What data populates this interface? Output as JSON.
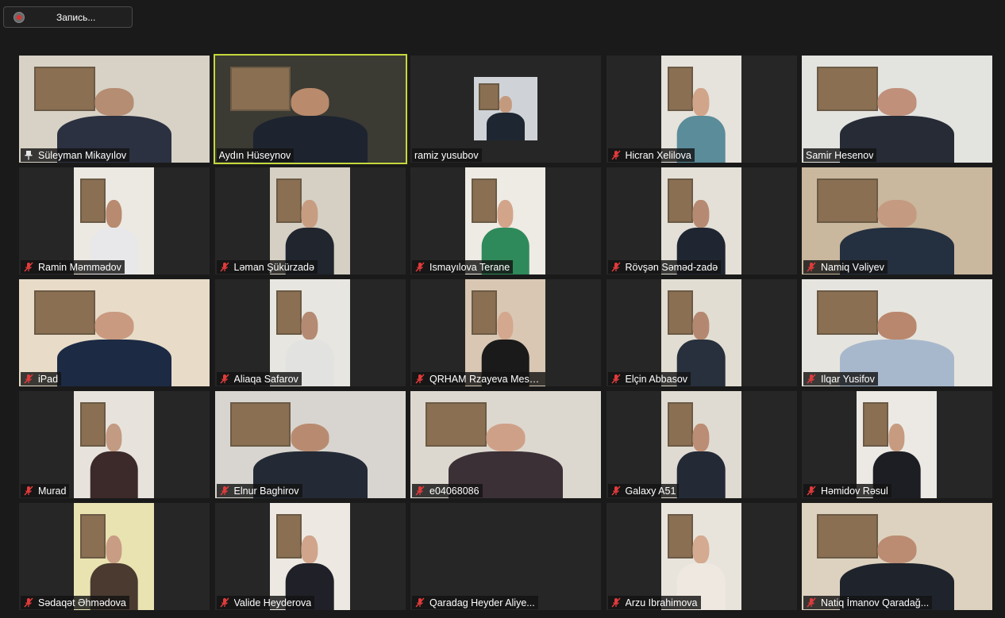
{
  "recording": {
    "label": "Запись..."
  },
  "participants": [
    {
      "name": "Süleyman Mikayılov",
      "icon": "pin-icon",
      "muted": false,
      "active": false,
      "layout": "full",
      "wall": "#d8d2c6",
      "skin": "#b58d73",
      "suit": "#2b3140"
    },
    {
      "name": "Aydın Hüseynov",
      "icon": "none",
      "muted": false,
      "active": true,
      "layout": "full",
      "wall": "#3b3a33",
      "skin": "#b98a6c",
      "suit": "#1d2430"
    },
    {
      "name": "ramiz yusubov",
      "icon": "none",
      "muted": false,
      "active": false,
      "layout": "small",
      "wall": "#cfd3d8",
      "skin": "#c49a7f",
      "suit": "#1e2632"
    },
    {
      "name": "Hicran Xelilova",
      "icon": "mic-muted-icon",
      "muted": true,
      "active": false,
      "layout": "center",
      "wall": "#e6e2dc",
      "skin": "#d1a58a",
      "suit": "#5a8c9a"
    },
    {
      "name": "Samir Hesenov",
      "icon": "none",
      "muted": false,
      "active": false,
      "layout": "full",
      "wall": "#e3e3e0",
      "skin": "#c0907a",
      "suit": "#262b36"
    },
    {
      "name": "Ramin Məmmədov",
      "icon": "mic-muted-icon",
      "muted": true,
      "active": false,
      "layout": "center",
      "wall": "#ece8e2",
      "skin": "#b88a6f",
      "suit": "#e8e8ea"
    },
    {
      "name": "Ləman Şükürzadə",
      "icon": "mic-muted-icon",
      "muted": true,
      "active": false,
      "layout": "center",
      "wall": "#d6d0c4",
      "skin": "#c79d82",
      "suit": "#20252e"
    },
    {
      "name": "Ismayılova Terane",
      "icon": "mic-muted-icon",
      "muted": true,
      "active": false,
      "layout": "center",
      "wall": "#eeeae4",
      "skin": "#d2a58b",
      "suit": "#2e8a5a"
    },
    {
      "name": "Rövşən Səməd-zadə",
      "icon": "mic-muted-icon",
      "muted": true,
      "active": false,
      "layout": "center",
      "wall": "#e4e0d8",
      "skin": "#b68a72",
      "suit": "#1f2632"
    },
    {
      "name": "Namiq Vəliyev",
      "icon": "mic-muted-icon",
      "muted": true,
      "active": false,
      "layout": "full",
      "wall": "#c9b79e",
      "skin": "#c49a80",
      "suit": "#24303f"
    },
    {
      "name": "iPad",
      "icon": "mic-muted-icon",
      "muted": true,
      "active": false,
      "layout": "full",
      "wall": "#e8dcc8",
      "skin": "#c99a80",
      "suit": "#1c2a44"
    },
    {
      "name": "Aliaqa Safarov",
      "icon": "mic-muted-icon",
      "muted": true,
      "active": false,
      "layout": "center",
      "wall": "#e8e6e0",
      "skin": "#b48a72",
      "suit": "#e2e2e0"
    },
    {
      "name": "QRHAM Rzayeva Mesu...",
      "icon": "mic-muted-icon",
      "muted": true,
      "active": false,
      "layout": "center",
      "wall": "#d9c7b3",
      "skin": "#d3a88e",
      "suit": "#1a1a1a"
    },
    {
      "name": "Elçin Abbasov",
      "icon": "mic-muted-icon",
      "muted": true,
      "active": false,
      "layout": "center",
      "wall": "#e2ddd2",
      "skin": "#b48870",
      "suit": "#27303c"
    },
    {
      "name": "Ilqar Yusifov",
      "icon": "mic-muted-icon",
      "muted": true,
      "active": false,
      "layout": "full",
      "wall": "#e6e4de",
      "skin": "#b9876d",
      "suit": "#a8b8cc"
    },
    {
      "name": "Murad",
      "icon": "mic-muted-icon",
      "muted": true,
      "active": false,
      "layout": "center",
      "wall": "#e7e3dc",
      "skin": "#c39a82",
      "suit": "#3c2a2a"
    },
    {
      "name": "Elnur Baghirov",
      "icon": "mic-muted-icon",
      "muted": true,
      "active": false,
      "layout": "full",
      "wall": "#d8d5d0",
      "skin": "#b88b70",
      "suit": "#242a35"
    },
    {
      "name": "e04068086",
      "icon": "mic-muted-icon",
      "muted": true,
      "active": false,
      "layout": "full",
      "wall": "#ddd8cf",
      "skin": "#cfa088",
      "suit": "#3a3036"
    },
    {
      "name": "Galaxy A51",
      "icon": "mic-muted-icon",
      "muted": true,
      "active": false,
      "layout": "center",
      "wall": "#e0dbd2",
      "skin": "#bb8d74",
      "suit": "#232a36"
    },
    {
      "name": "Həmidov Rəsul",
      "icon": "mic-muted-icon",
      "muted": true,
      "active": false,
      "layout": "center",
      "wall": "#ece9e4",
      "skin": "#c69b80",
      "suit": "#1c1e24"
    },
    {
      "name": "Sədaqət Əhmədova",
      "icon": "mic-muted-icon",
      "muted": true,
      "active": false,
      "layout": "center",
      "wall": "#e9e3b2",
      "skin": "#c89d84",
      "suit": "#4a3a30"
    },
    {
      "name": "Valide Heyderova",
      "icon": "mic-muted-icon",
      "muted": true,
      "active": false,
      "layout": "center",
      "wall": "#ede9e2",
      "skin": "#d0a58b",
      "suit": "#202028"
    },
    {
      "name": "Qaradag Heyder Aliye...",
      "icon": "mic-muted-icon",
      "muted": true,
      "active": false,
      "layout": "empty",
      "wall": "#262626",
      "skin": "#262626",
      "suit": "#262626"
    },
    {
      "name": "Arzu Ibrahimova",
      "icon": "mic-muted-icon",
      "muted": true,
      "active": false,
      "layout": "center",
      "wall": "#e8e4dc",
      "skin": "#d4aa90",
      "suit": "#efe8e0"
    },
    {
      "name": "Natiq İmanov Qaradağ...",
      "icon": "mic-muted-icon",
      "muted": true,
      "active": false,
      "layout": "full",
      "wall": "#ddd2bf",
      "skin": "#bb8c72",
      "suit": "#1f242c"
    }
  ]
}
